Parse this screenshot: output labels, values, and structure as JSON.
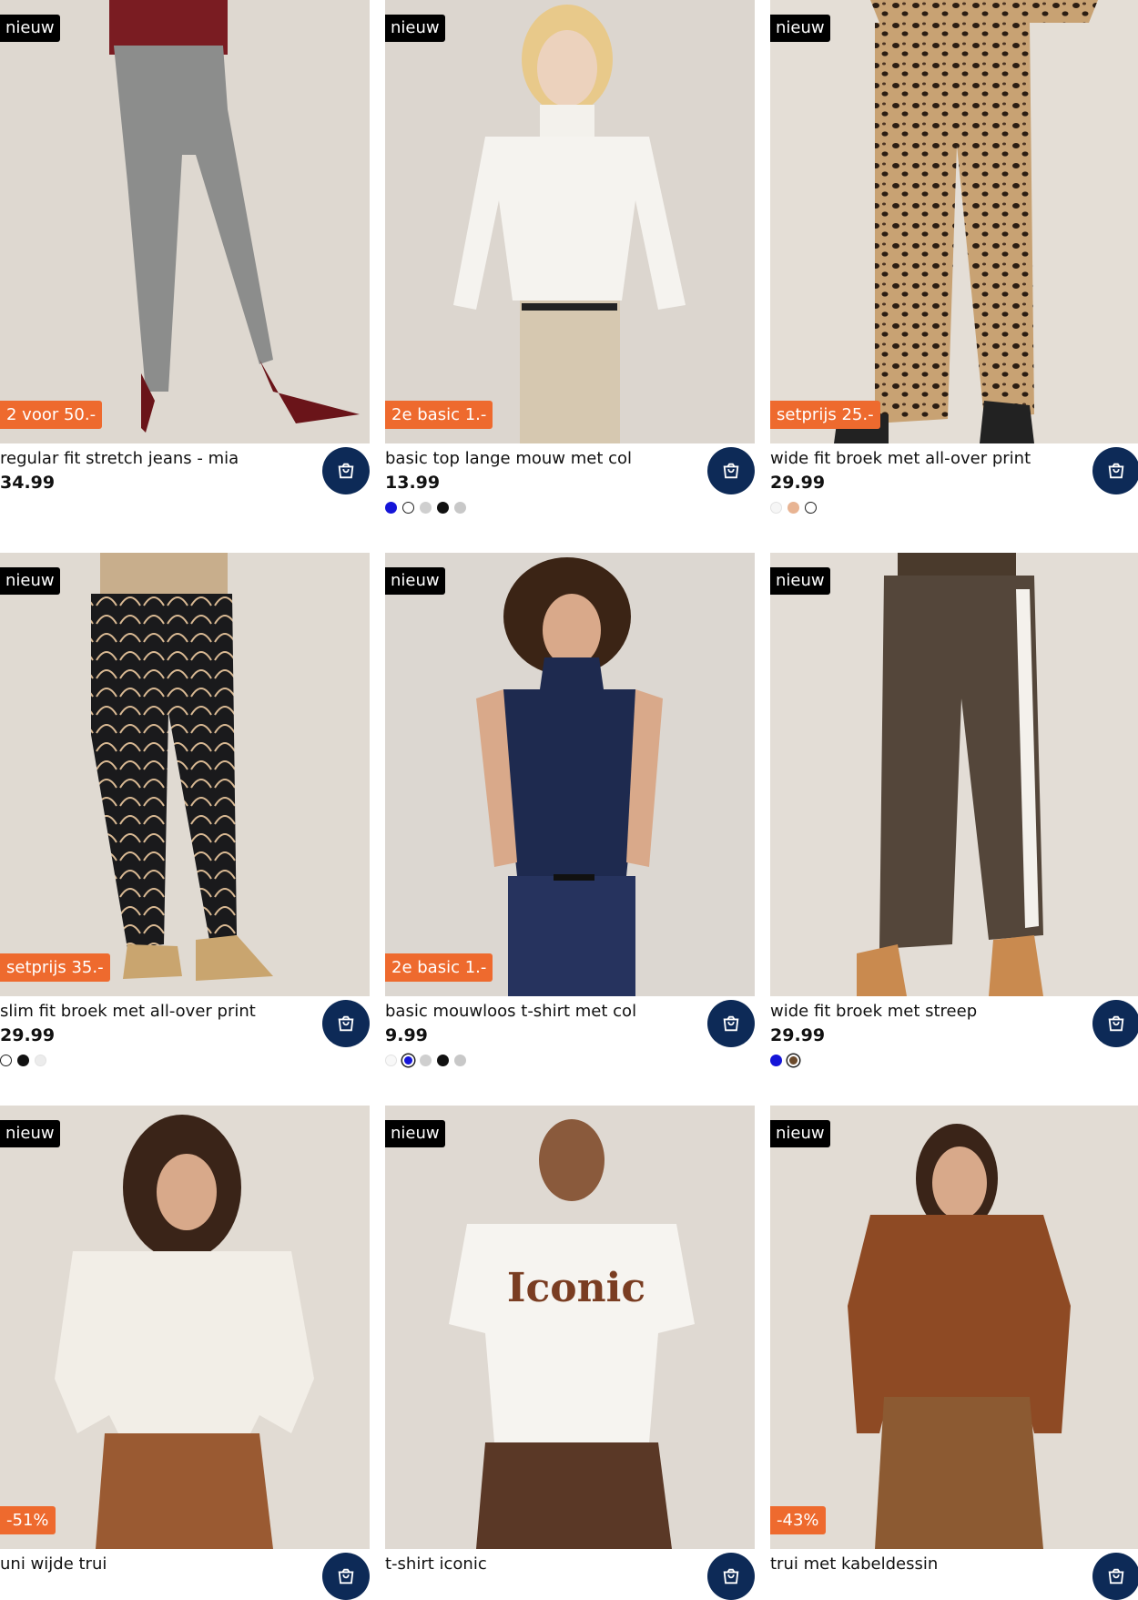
{
  "products": [
    {
      "name": "regular fit stretch jeans - mia",
      "price": "34.99",
      "badge": "nieuw",
      "promo": "2 voor 50.-",
      "colors": []
    },
    {
      "name": "basic top lange mouw met col",
      "price": "13.99",
      "badge": "nieuw",
      "promo": "2e basic 1.-",
      "colors": [
        "#1515d8",
        "#ffffff",
        "#cfcfcf",
        "#111111",
        "#c8c8c8"
      ]
    },
    {
      "name": "wide fit broek met all-over print",
      "price": "29.99",
      "badge": "nieuw",
      "promo": "setprijs 25.-",
      "colors": [
        "#f6f6f6",
        "#e8b493",
        "#ffffff"
      ]
    },
    {
      "name": "slim fit broek met all-over print",
      "price": "29.99",
      "badge": "nieuw",
      "promo": "setprijs 35.-",
      "colors": [
        "#ffffff",
        "#111111",
        "#ececec"
      ]
    },
    {
      "name": "basic mouwloos t-shirt met col",
      "price": "9.99",
      "badge": "nieuw",
      "promo": "2e basic 1.-",
      "colors": [
        "#f8f8f8",
        "#1515d8",
        "#cfcfcf",
        "#111111",
        "#c8c8c8"
      ]
    },
    {
      "name": "wide fit broek met streep",
      "price": "29.99",
      "badge": "nieuw",
      "promo": "",
      "colors": [
        "#1515d8",
        "#6b4a2c"
      ]
    },
    {
      "name": "uni wijde trui",
      "price": "",
      "badge": "nieuw",
      "promo": "-51%",
      "colors": []
    },
    {
      "name": "t-shirt iconic",
      "price": "",
      "badge": "nieuw",
      "promo": "",
      "colors": []
    },
    {
      "name": "trui met kabeldessin",
      "price": "",
      "badge": "nieuw",
      "promo": "-43%",
      "colors": []
    }
  ],
  "photo_print": "Iconic",
  "colors": {
    "accent_navy": "#0d2a57",
    "promo_orange": "#ee6a2e",
    "badge_black": "#000000"
  },
  "icons": {
    "cart": "shopping-bag-icon"
  }
}
